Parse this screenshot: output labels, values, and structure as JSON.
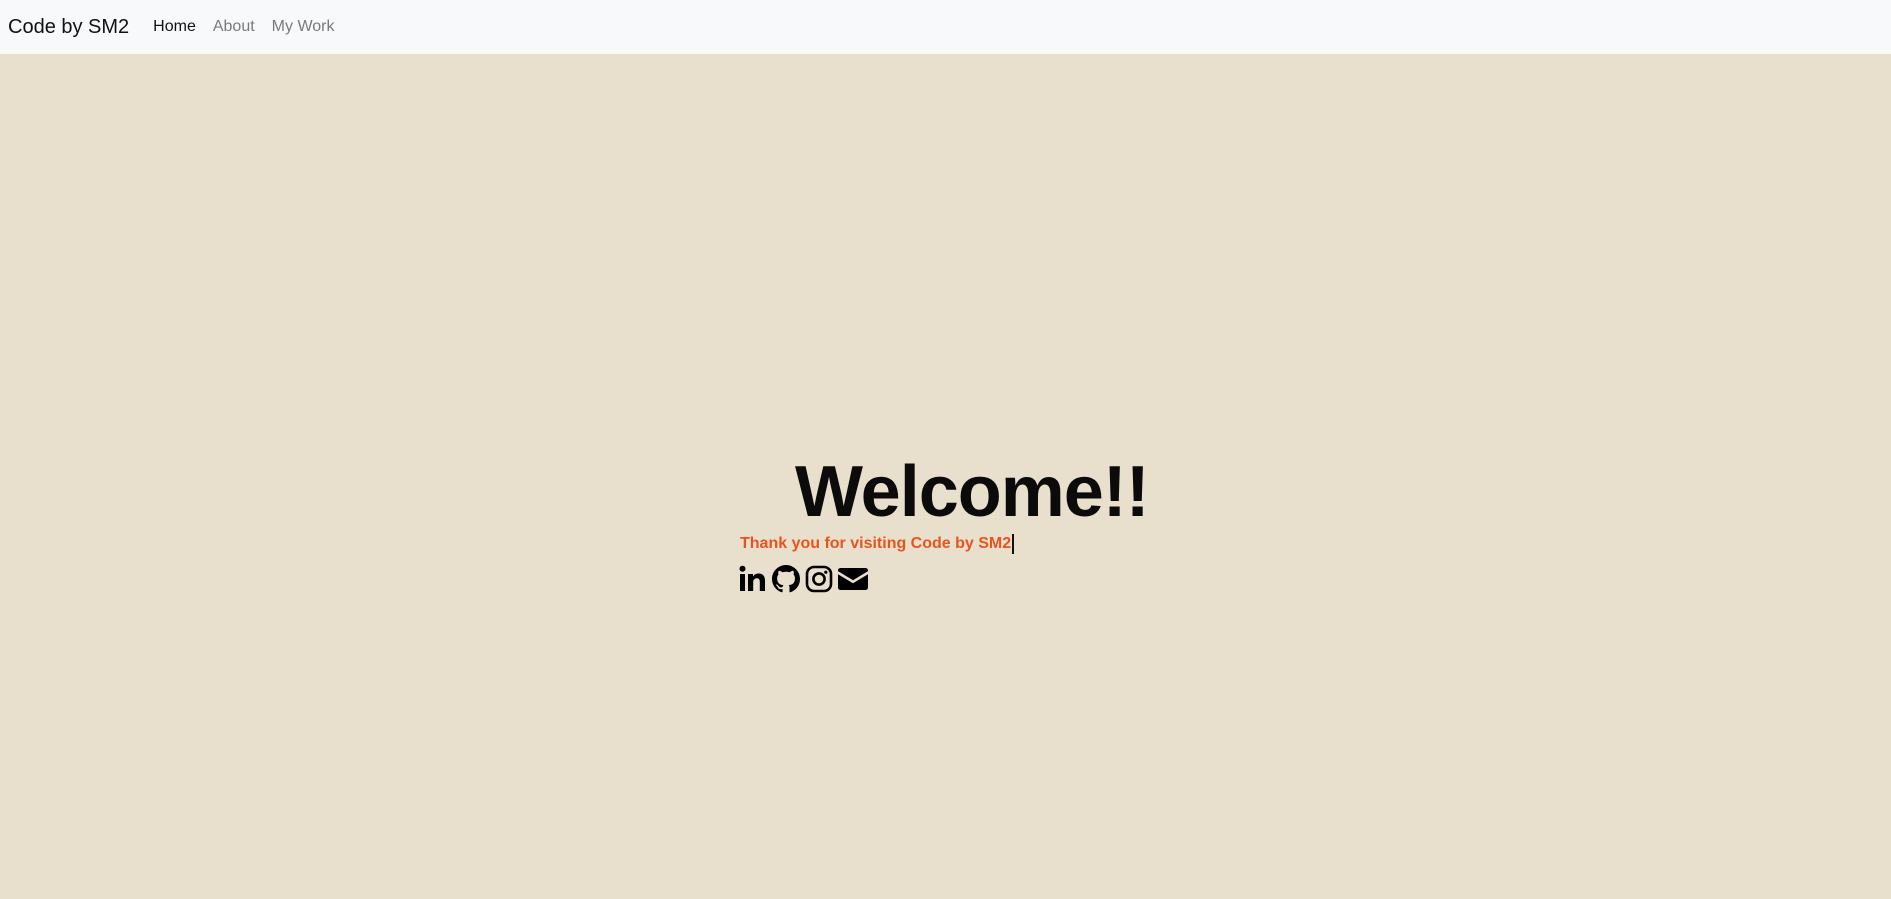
{
  "navbar": {
    "brand": "Code by SM2",
    "links": [
      {
        "label": "Home",
        "active": true
      },
      {
        "label": "About",
        "active": false
      },
      {
        "label": "My Work",
        "active": false
      }
    ]
  },
  "hero": {
    "heading": "Welcome!!",
    "tagline": "Thank you for visiting Code by SM2",
    "social_icons": [
      "linkedin-icon",
      "github-icon",
      "instagram-icon",
      "envelope-icon"
    ]
  },
  "colors": {
    "background": "#e8dfcd",
    "navbar_bg": "#f8f9fb",
    "accent": "#e8541d",
    "text": "#0b0b0b",
    "nav_inactive": "#7a7a7a"
  }
}
